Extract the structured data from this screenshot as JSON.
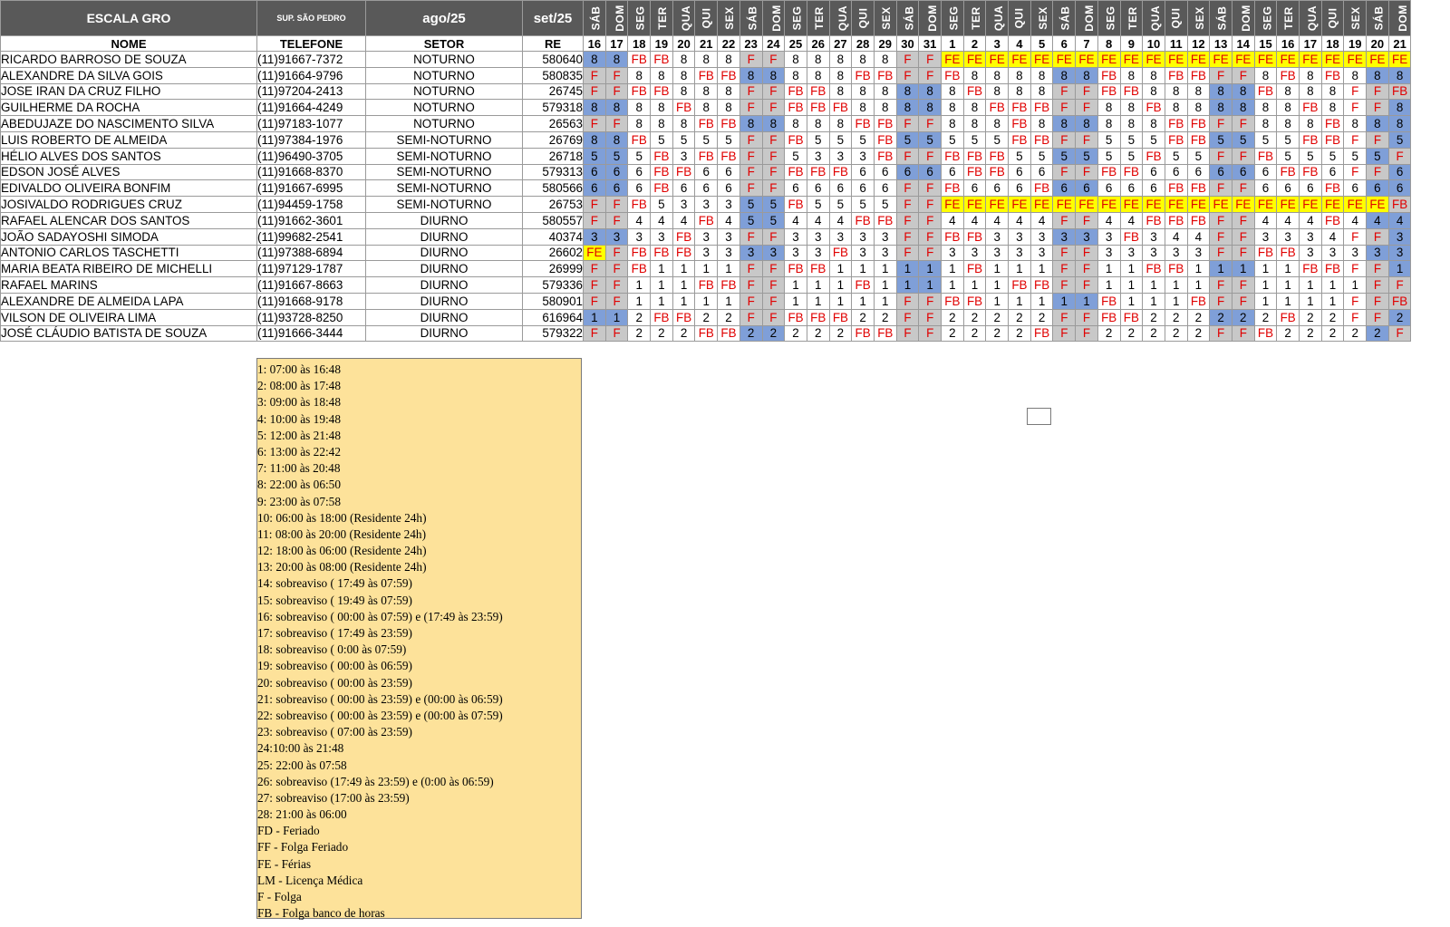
{
  "header": {
    "title": "ESCALA GRO",
    "supervisor": "SUP. SÃO PEDRO",
    "month1": "ago/25",
    "month2": "set/25"
  },
  "columns": {
    "name": "NOME",
    "phone": "TELEFONE",
    "sector": "SETOR",
    "re": "RE"
  },
  "days": [
    {
      "dow": "SÁB",
      "d": "16"
    },
    {
      "dow": "DOM",
      "d": "17"
    },
    {
      "dow": "SEG",
      "d": "18"
    },
    {
      "dow": "TER",
      "d": "19"
    },
    {
      "dow": "QUA",
      "d": "20"
    },
    {
      "dow": "QUI",
      "d": "21"
    },
    {
      "dow": "SEX",
      "d": "22"
    },
    {
      "dow": "SÁB",
      "d": "23"
    },
    {
      "dow": "DOM",
      "d": "24"
    },
    {
      "dow": "SEG",
      "d": "25"
    },
    {
      "dow": "TER",
      "d": "26"
    },
    {
      "dow": "QUA",
      "d": "27"
    },
    {
      "dow": "QUI",
      "d": "28"
    },
    {
      "dow": "SEX",
      "d": "29"
    },
    {
      "dow": "SÁB",
      "d": "30"
    },
    {
      "dow": "DOM",
      "d": "31"
    },
    {
      "dow": "SEG",
      "d": "1"
    },
    {
      "dow": "TER",
      "d": "2"
    },
    {
      "dow": "QUA",
      "d": "3"
    },
    {
      "dow": "QUI",
      "d": "4"
    },
    {
      "dow": "SEX",
      "d": "5"
    },
    {
      "dow": "SÁB",
      "d": "6"
    },
    {
      "dow": "DOM",
      "d": "7"
    },
    {
      "dow": "SEG",
      "d": "8"
    },
    {
      "dow": "TER",
      "d": "9"
    },
    {
      "dow": "QUA",
      "d": "10"
    },
    {
      "dow": "QUI",
      "d": "11"
    },
    {
      "dow": "SEX",
      "d": "12"
    },
    {
      "dow": "SÁB",
      "d": "13"
    },
    {
      "dow": "DOM",
      "d": "14"
    },
    {
      "dow": "SEG",
      "d": "15"
    },
    {
      "dow": "TER",
      "d": "16"
    },
    {
      "dow": "QUA",
      "d": "17"
    },
    {
      "dow": "QUI",
      "d": "18"
    },
    {
      "dow": "SEX",
      "d": "19"
    },
    {
      "dow": "SÁB",
      "d": "20"
    },
    {
      "dow": "DOM",
      "d": "21"
    }
  ],
  "employees": [
    {
      "name": "RICARDO BARROSO DE SOUZA",
      "phone": "(11)91667-7372",
      "sector": "NOTURNO",
      "re": "580640",
      "shifts": [
        "8",
        "8",
        "FB",
        "FB",
        "8",
        "8",
        "8",
        "F",
        "F",
        "8",
        "8",
        "8",
        "8",
        "8",
        "F",
        "F",
        "FE",
        "FE",
        "FE",
        "FE",
        "FE",
        "FE",
        "FE",
        "FE",
        "FE",
        "FE",
        "FE",
        "FE",
        "FE",
        "FE",
        "FE",
        "FE",
        "FE",
        "FE",
        "FE",
        "FE",
        "FE"
      ]
    },
    {
      "name": "ALEXANDRE DA SILVA GOIS",
      "phone": "(11)91664-9796",
      "sector": "NOTURNO",
      "re": "580835",
      "shifts": [
        "F",
        "F",
        "8",
        "8",
        "8",
        "FB",
        "FB",
        "8",
        "8",
        "8",
        "8",
        "8",
        "FB",
        "FB",
        "F",
        "F",
        "FB",
        "8",
        "8",
        "8",
        "8",
        "8",
        "8",
        "FB",
        "8",
        "8",
        "FB",
        "FB",
        "F",
        "F",
        "8",
        "FB",
        "8",
        "FB",
        "8",
        "8",
        "8"
      ]
    },
    {
      "name": "JOSE IRAN DA CRUZ FILHO",
      "phone": "(11)97204-2413",
      "sector": "NOTURNO",
      "re": "26745",
      "shifts": [
        "F",
        "F",
        "FB",
        "FB",
        "8",
        "8",
        "8",
        "F",
        "F",
        "FB",
        "FB",
        "8",
        "8",
        "8",
        "8",
        "8",
        "8",
        "FB",
        "8",
        "8",
        "8",
        "F",
        "F",
        "FB",
        "FB",
        "8",
        "8",
        "8",
        "8",
        "8",
        "FB",
        "8",
        "8",
        "8",
        "F",
        "F",
        "FB"
      ]
    },
    {
      "name": "GUILHERME DA ROCHA",
      "phone": "(11)91664-4249",
      "sector": "NOTURNO",
      "re": "579318",
      "shifts": [
        "8",
        "8",
        "8",
        "8",
        "FB",
        "8",
        "8",
        "F",
        "F",
        "FB",
        "FB",
        "FB",
        "8",
        "8",
        "8",
        "8",
        "8",
        "8",
        "FB",
        "FB",
        "FB",
        "F",
        "F",
        "8",
        "8",
        "FB",
        "8",
        "8",
        "8",
        "8",
        "8",
        "8",
        "FB",
        "8",
        "F",
        "F",
        "8"
      ]
    },
    {
      "name": "ABEDUJAZE DO NASCIMENTO SILVA",
      "phone": "(11)97183-1077",
      "sector": "NOTURNO",
      "re": "26563",
      "shifts": [
        "F",
        "F",
        "8",
        "8",
        "8",
        "FB",
        "FB",
        "8",
        "8",
        "8",
        "8",
        "8",
        "FB",
        "FB",
        "F",
        "F",
        "8",
        "8",
        "8",
        "FB",
        "8",
        "8",
        "8",
        "8",
        "8",
        "8",
        "FB",
        "FB",
        "F",
        "F",
        "8",
        "8",
        "8",
        "FB",
        "8",
        "8",
        "8"
      ]
    },
    {
      "name": "LUIS ROBERTO DE ALMEIDA",
      "phone": "(11)97384-1976",
      "sector": "SEMI-NOTURNO",
      "re": "26769",
      "shifts": [
        "8",
        "8",
        "FB",
        "5",
        "5",
        "5",
        "5",
        "F",
        "F",
        "FB",
        "5",
        "5",
        "5",
        "FB",
        "5",
        "5",
        "5",
        "5",
        "5",
        "FB",
        "FB",
        "F",
        "F",
        "5",
        "5",
        "5",
        "FB",
        "FB",
        "5",
        "5",
        "5",
        "5",
        "FB",
        "FB",
        "F",
        "F",
        "5"
      ]
    },
    {
      "name": "HÉLIO ALVES DOS SANTOS",
      "phone": "(11)96490-3705",
      "sector": "SEMI-NOTURNO",
      "re": "26718",
      "shifts": [
        "5",
        "5",
        "5",
        "FB",
        "3",
        "FB",
        "FB",
        "F",
        "F",
        "5",
        "3",
        "3",
        "3",
        "FB",
        "F",
        "F",
        "FB",
        "FB",
        "FB",
        "5",
        "5",
        "5",
        "5",
        "5",
        "5",
        "FB",
        "5",
        "5",
        "F",
        "F",
        "FB",
        "5",
        "5",
        "5",
        "5",
        "5",
        "F"
      ]
    },
    {
      "name": "EDSON JOSÉ ALVES",
      "phone": "(11)91668-8370",
      "sector": "SEMI-NOTURNO",
      "re": "579313",
      "shifts": [
        "6",
        "6",
        "6",
        "FB",
        "FB",
        "6",
        "6",
        "F",
        "F",
        "FB",
        "FB",
        "FB",
        "6",
        "6",
        "6",
        "6",
        "6",
        "FB",
        "FB",
        "6",
        "6",
        "F",
        "F",
        "FB",
        "FB",
        "6",
        "6",
        "6",
        "6",
        "6",
        "6",
        "FB",
        "FB",
        "6",
        "F",
        "F",
        "6"
      ]
    },
    {
      "name": "EDIVALDO OLIVEIRA BONFIM",
      "phone": "(11)91667-6995",
      "sector": "SEMI-NOTURNO",
      "re": "580566",
      "shifts": [
        "6",
        "6",
        "6",
        "FB",
        "6",
        "6",
        "6",
        "F",
        "F",
        "6",
        "6",
        "6",
        "6",
        "6",
        "F",
        "F",
        "FB",
        "6",
        "6",
        "6",
        "FB",
        "6",
        "6",
        "6",
        "6",
        "6",
        "FB",
        "FB",
        "F",
        "F",
        "6",
        "6",
        "6",
        "FB",
        "6",
        "6",
        "6"
      ]
    },
    {
      "name": "JOSIVALDO RODRIGUES CRUZ",
      "phone": "(11)94459-1758",
      "sector": "SEMI-NOTURNO",
      "re": "26753",
      "shifts": [
        "F",
        "F",
        "FB",
        "5",
        "3",
        "3",
        "3",
        "5",
        "5",
        "FB",
        "5",
        "5",
        "5",
        "5",
        "F",
        "F",
        "FE",
        "FE",
        "FE",
        "FE",
        "FE",
        "FE",
        "FE",
        "FE",
        "FE",
        "FE",
        "FE",
        "FE",
        "FE",
        "FE",
        "FE",
        "FE",
        "FE",
        "FE",
        "FE",
        "FE",
        "FB"
      ]
    },
    {
      "name": "RAFAEL ALENCAR DOS SANTOS",
      "phone": "(11)91662-3601",
      "sector": "DIURNO",
      "re": "580557",
      "shifts": [
        "F",
        "F",
        "4",
        "4",
        "4",
        "FB",
        "4",
        "5",
        "5",
        "4",
        "4",
        "4",
        "FB",
        "FB",
        "F",
        "F",
        "4",
        "4",
        "4",
        "4",
        "4",
        "F",
        "F",
        "4",
        "4",
        "FB",
        "FB",
        "FB",
        "F",
        "F",
        "4",
        "4",
        "4",
        "FB",
        "4",
        "4",
        "4"
      ]
    },
    {
      "name": "JOÃO SADAYOSHI SIMODA",
      "phone": "(11)99682-2541",
      "sector": "DIURNO",
      "re": "40374",
      "shifts": [
        "3",
        "3",
        "3",
        "3",
        "FB",
        "3",
        "3",
        "F",
        "F",
        "3",
        "3",
        "3",
        "3",
        "3",
        "F",
        "F",
        "FB",
        "FB",
        "3",
        "3",
        "3",
        "3",
        "3",
        "3",
        "FB",
        "3",
        "4",
        "4",
        "F",
        "F",
        "3",
        "3",
        "3",
        "4",
        "F",
        "F",
        "3"
      ]
    },
    {
      "name": "ANTONIO CARLOS TASCHETTI",
      "phone": "(11)97388-6894",
      "sector": "DIURNO",
      "re": "26602",
      "shifts": [
        "FE",
        "F",
        "FB",
        "FB",
        "FB",
        "3",
        "3",
        "3",
        "3",
        "3",
        "3",
        "FB",
        "3",
        "3",
        "F",
        "F",
        "3",
        "3",
        "3",
        "3",
        "3",
        "F",
        "F",
        "3",
        "3",
        "3",
        "3",
        "3",
        "F",
        "F",
        "FB",
        "FB",
        "3",
        "3",
        "3",
        "3",
        "3"
      ]
    },
    {
      "name": "MARIA BEATA RIBEIRO DE MICHELLI",
      "phone": "(11)97129-1787",
      "sector": "DIURNO",
      "re": "26999",
      "shifts": [
        "F",
        "F",
        "FB",
        "1",
        "1",
        "1",
        "1",
        "F",
        "F",
        "FB",
        "FB",
        "1",
        "1",
        "1",
        "1",
        "1",
        "1",
        "FB",
        "1",
        "1",
        "1",
        "F",
        "F",
        "1",
        "1",
        "FB",
        "FB",
        "1",
        "1",
        "1",
        "1",
        "1",
        "FB",
        "FB",
        "F",
        "F",
        "1"
      ]
    },
    {
      "name": "RAFAEL MARINS",
      "phone": "(11)91667-8663",
      "sector": "DIURNO",
      "re": "579336",
      "shifts": [
        "F",
        "F",
        "1",
        "1",
        "1",
        "FB",
        "FB",
        "F",
        "F",
        "1",
        "1",
        "1",
        "FB",
        "1",
        "1",
        "1",
        "1",
        "1",
        "1",
        "FB",
        "FB",
        "F",
        "F",
        "1",
        "1",
        "1",
        "1",
        "1",
        "F",
        "F",
        "1",
        "1",
        "1",
        "1",
        "1",
        "F",
        "F"
      ]
    },
    {
      "name": "ALEXANDRE DE ALMEIDA LAPA",
      "phone": "(11)91668-9178",
      "sector": "DIURNO",
      "re": "580901",
      "shifts": [
        "F",
        "F",
        "1",
        "1",
        "1",
        "1",
        "1",
        "F",
        "F",
        "1",
        "1",
        "1",
        "1",
        "1",
        "F",
        "F",
        "FB",
        "FB",
        "1",
        "1",
        "1",
        "1",
        "1",
        "FB",
        "1",
        "1",
        "1",
        "FB",
        "F",
        "F",
        "1",
        "1",
        "1",
        "1",
        "F",
        "F",
        "FB"
      ]
    },
    {
      "name": "VILSON DE OLIVEIRA LIMA",
      "phone": "(11)93728-8250",
      "sector": "DIURNO",
      "re": "616964",
      "shifts": [
        "1",
        "1",
        "2",
        "FB",
        "FB",
        "2",
        "2",
        "F",
        "F",
        "FB",
        "FB",
        "FB",
        "2",
        "2",
        "F",
        "F",
        "2",
        "2",
        "2",
        "2",
        "2",
        "F",
        "F",
        "FB",
        "FB",
        "2",
        "2",
        "2",
        "2",
        "2",
        "2",
        "FB",
        "2",
        "2",
        "F",
        "F",
        "2"
      ]
    },
    {
      "name": "JOSÉ CLÁUDIO BATISTA DE SOUZA",
      "phone": "(11)91666-3444",
      "sector": "DIURNO",
      "re": "579322",
      "shifts": [
        "F",
        "F",
        "2",
        "2",
        "2",
        "FB",
        "FB",
        "2",
        "2",
        "2",
        "2",
        "2",
        "FB",
        "FB",
        "F",
        "F",
        "2",
        "2",
        "2",
        "2",
        "FB",
        "F",
        "F",
        "2",
        "2",
        "2",
        "2",
        "2",
        "F",
        "F",
        "FB",
        "2",
        "2",
        "2",
        "2",
        "2",
        "F"
      ]
    }
  ],
  "legend": [
    "1: 07:00 às 16:48",
    "2: 08:00 às 17:48",
    "3: 09:00 às 18:48",
    "4: 10:00 às 19:48",
    "5: 12:00 às 21:48",
    "6: 13:00 às 22:42",
    "7: 11:00 às 20:48",
    "8: 22:00 às 06:50",
    "9: 23:00 às 07:58",
    "10: 06:00 às 18:00 (Residente 24h)",
    "11: 08:00 às 20:00 (Residente 24h)",
    "12: 18:00 às 06:00 (Residente 24h)",
    "13: 20:00 às 08:00 (Residente 24h)",
    "14: sobreaviso ( 17:49 às 07:59)",
    "15: sobreaviso ( 19:49 às 07:59)",
    "16: sobreaviso ( 00:00 às 07:59) e (17:49 às 23:59)",
    "17: sobreaviso ( 17:49 às 23:59)",
    "18: sobreaviso ( 0:00 às 07:59)",
    "19: sobreaviso ( 00:00 às 06:59)",
    "20: sobreaviso ( 00:00 às 23:59)",
    "21: sobreaviso ( 00:00 às 23:59) e (00:00 às 06:59)",
    "22: sobreaviso ( 00:00 às 23:59) e (00:00 às 07:59)",
    "23: sobreaviso ( 07:00 às 23:59)",
    "24:10:00 às 21:48",
    "25: 22:00 às 07:58",
    "26: sobreaviso (17:49 às 23:59) e (0:00 às 06:59)",
    "27: sobreaviso (17:00 às 23:59)",
    "28: 21:00 às 06:00",
    "FD - Feriado",
    "FF - Folga Feriado",
    "FE - Férias",
    "LM - Licença Médica",
    "F - Folga",
    "FB - Folga banco de horas"
  ],
  "colors": {
    "header_bg": "#595959",
    "weekend_gray": "#c8c8c8",
    "working_weekend_blue": "#7f9fd8",
    "vacation_yellow": "#ffff00",
    "off_red": "#e00000",
    "legend_bg": "#fde29a"
  }
}
